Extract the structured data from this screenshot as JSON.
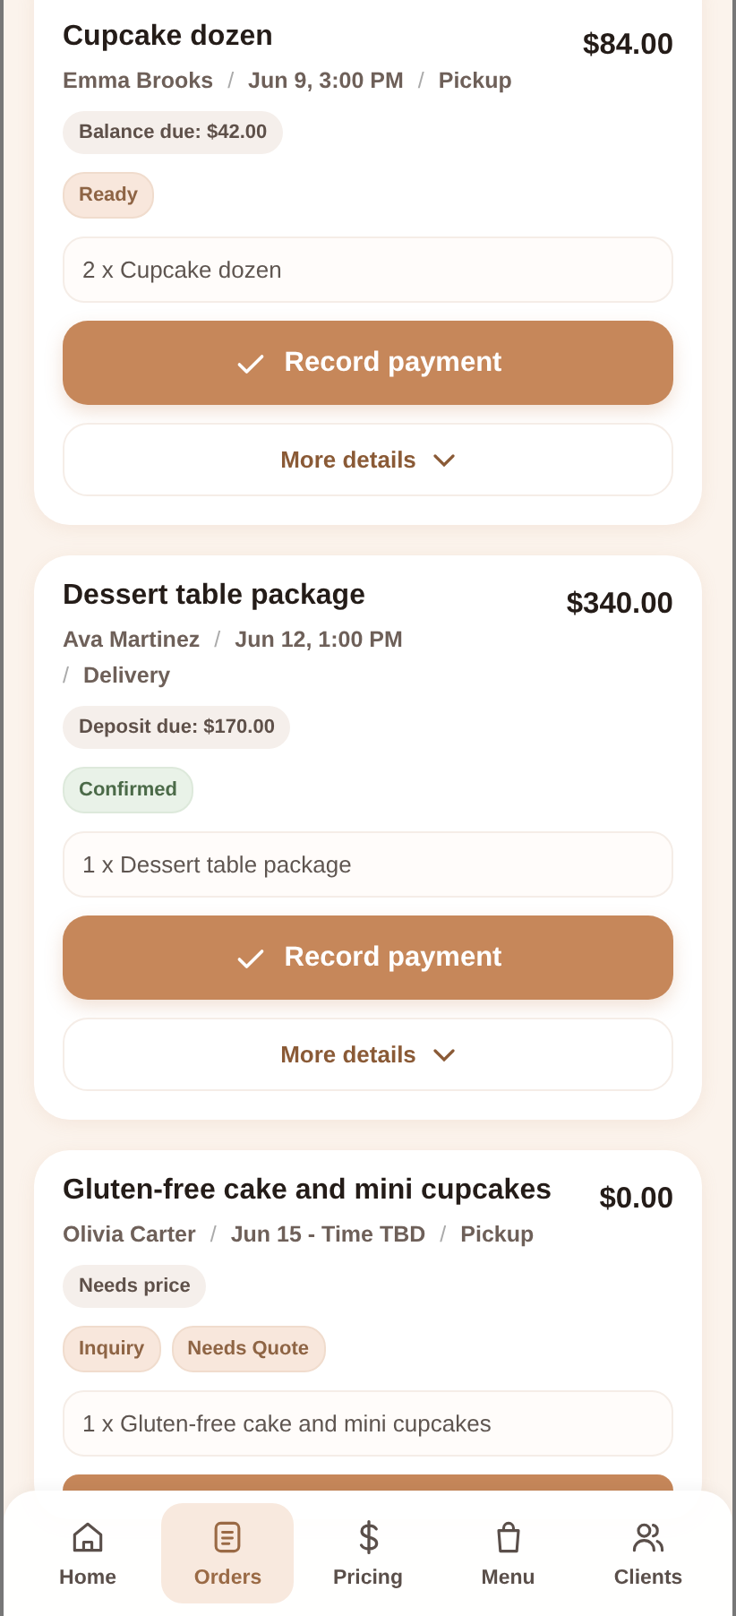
{
  "orders": [
    {
      "title": "Cupcake dozen",
      "amount": "$84.00",
      "separator": "/",
      "meta": [
        "Emma Brooks",
        "Jun 9, 3:00 PM",
        "Pickup"
      ],
      "due": "Balance due: $42.00",
      "tags": [
        {
          "label": "Ready",
          "kind": "warm"
        }
      ],
      "items": "2 x Cupcake dozen",
      "action": "Record payment",
      "details": "More details"
    },
    {
      "title": "Dessert table package",
      "amount": "$340.00",
      "separator": "/",
      "meta": [
        "Ava Martinez",
        "Jun 12, 1:00 PM",
        "Delivery"
      ],
      "due": "Deposit due: $170.00",
      "tags": [
        {
          "label": "Confirmed",
          "kind": "green"
        }
      ],
      "items": "1 x Dessert table package",
      "action": "Record payment",
      "details": "More details"
    },
    {
      "title": "Gluten-free cake and mini cupcakes",
      "amount": "$0.00",
      "separator": "/",
      "meta": [
        "Olivia Carter",
        "Jun 15 - Time TBD",
        "Pickup"
      ],
      "due": "Needs price",
      "tags": [
        {
          "label": "Inquiry",
          "kind": "warm"
        },
        {
          "label": "Needs Quote",
          "kind": "warm"
        }
      ],
      "items": "1 x Gluten-free cake and mini cupcakes"
    }
  ],
  "nav": [
    {
      "label": "Home",
      "selected": false
    },
    {
      "label": "Orders",
      "selected": true
    },
    {
      "label": "Pricing",
      "selected": false
    },
    {
      "label": "Menu",
      "selected": false
    },
    {
      "label": "Clients",
      "selected": false
    }
  ]
}
